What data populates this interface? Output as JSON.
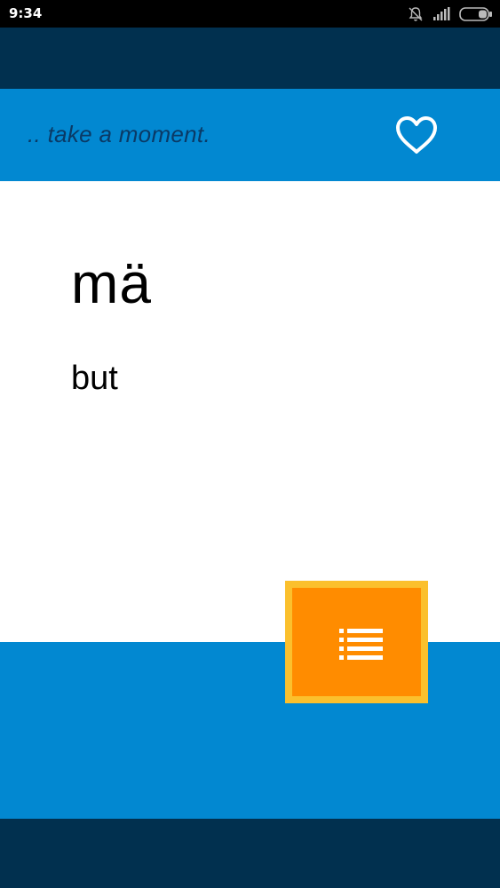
{
  "status_bar": {
    "time": "9:34",
    "icons": [
      "notifications-off-icon",
      "signal-icon",
      "battery-icon"
    ]
  },
  "header": {
    "tagline": ".. take a moment.",
    "favorite_icon": "heart-outline-icon"
  },
  "card": {
    "word": "mä",
    "translation": "but"
  },
  "actions": {
    "list_icon": "list-icon"
  },
  "colors": {
    "dark_navy": "#01304f",
    "primary_blue": "#0288d1",
    "tagline_text": "#0a3a66",
    "accent_orange": "#ff8c00",
    "accent_border": "#fbc02d"
  }
}
